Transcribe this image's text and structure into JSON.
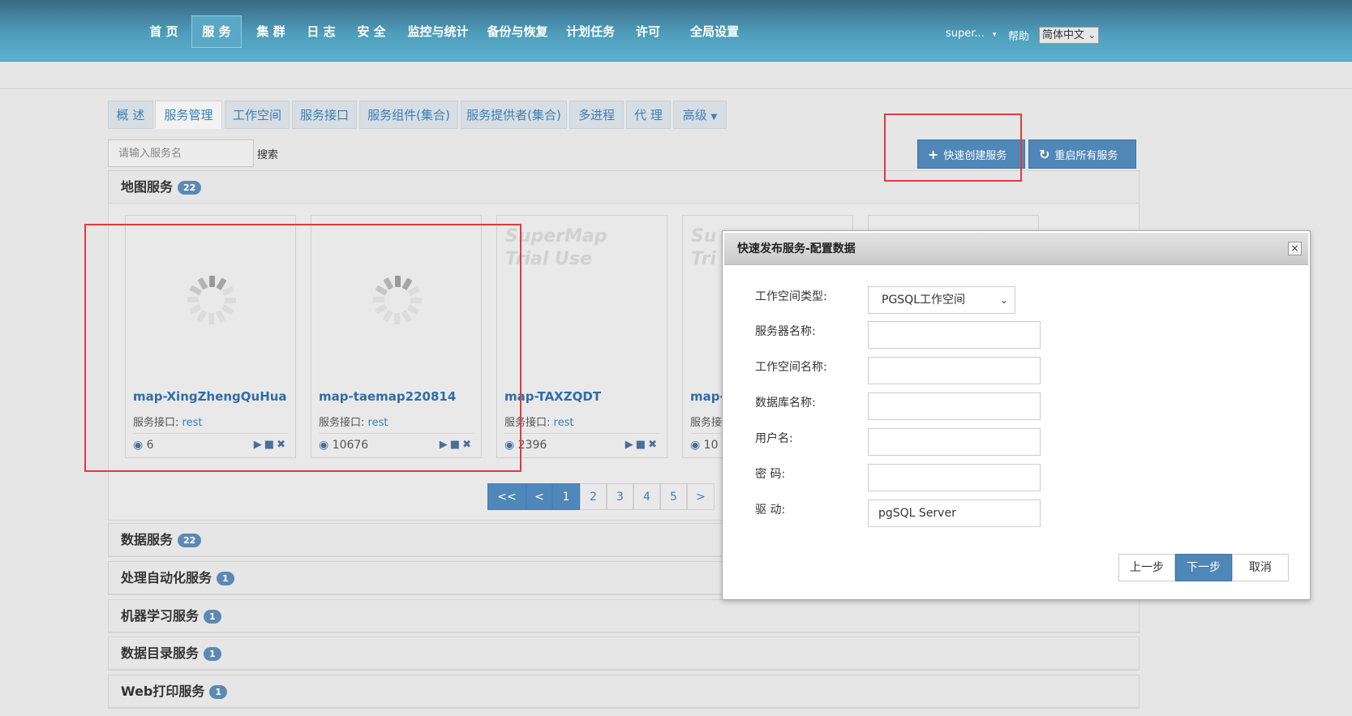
{
  "nav": {
    "items": [
      "首 页",
      "服 务",
      "集 群",
      "日 志",
      "安 全",
      "监控与统计",
      "备份与恢复",
      "计划任务",
      "许可",
      "全局设置"
    ],
    "user": "super...",
    "help": "帮助",
    "language": "简体中文"
  },
  "tabs": [
    "概 述",
    "服务管理",
    "工作空间",
    "服务接口",
    "服务组件(集合)",
    "服务提供者(集合)",
    "多进程",
    "代 理",
    "高级"
  ],
  "search": {
    "placeholder": "请输入服务名",
    "button": "搜索"
  },
  "actions": {
    "quick_create": "快速创建服务",
    "restart_all": "重启所有服务"
  },
  "map_panel": {
    "title": "地图服务",
    "count": "22",
    "cards": [
      {
        "name": "map-XingZhengQuHua",
        "interface_label": "服务接口:",
        "interface": "rest",
        "views": "6"
      },
      {
        "name": "map-taemap220814",
        "interface_label": "服务接口:",
        "interface": "rest",
        "views": "10676"
      },
      {
        "name": "map-TAXZQDT",
        "interface_label": "服务接口:",
        "interface": "rest",
        "views": "2396",
        "watermark": "SuperMap Trial Use"
      },
      {
        "name": "map-",
        "interface_label": "服务接",
        "interface": "",
        "views": "10",
        "watermark": "Su Tri"
      }
    ],
    "pager": [
      "<<",
      "<",
      "1",
      "2",
      "3",
      "4",
      "5",
      ">"
    ]
  },
  "panels": [
    {
      "title": "数据服务",
      "count": "22"
    },
    {
      "title": "处理自动化服务",
      "count": "1"
    },
    {
      "title": "机器学习服务",
      "count": "1"
    },
    {
      "title": "数据目录服务",
      "count": "1"
    },
    {
      "title": "Web打印服务",
      "count": "1"
    }
  ],
  "modal": {
    "title": "快速发布服务-配置数据",
    "close": "×",
    "fields": {
      "workspace_type": {
        "label": "工作空间类型:",
        "value": "PGSQL工作空间"
      },
      "server_name": {
        "label": "服务器名称:",
        "value": ""
      },
      "workspace_name": {
        "label": "工作空间名称:",
        "value": ""
      },
      "database_name": {
        "label": "数据库名称:",
        "value": ""
      },
      "username": {
        "label": "用户名:",
        "value": ""
      },
      "password": {
        "label": "密 码:",
        "value": ""
      },
      "driver": {
        "label": "驱 动:",
        "value": "pgSQL Server"
      }
    },
    "buttons": {
      "prev": "上一步",
      "next": "下一步",
      "cancel": "取消"
    }
  },
  "colors": {
    "accent": "#4f87b8",
    "header": "#4e9dbb",
    "highlight_box": "#e03b3b"
  }
}
